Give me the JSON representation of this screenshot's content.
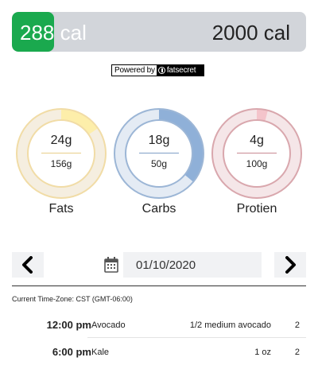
{
  "calories": {
    "consumed_label": "288 cal",
    "goal_label": "2000 cal",
    "progress": 0.144,
    "fill_color": "#1aa94e",
    "track_color": "#d2d5da"
  },
  "powered_by": {
    "prefix": "Powered by",
    "brand": "fatsecret"
  },
  "macros": [
    {
      "name": "Fats",
      "value": "24g",
      "goal": "156g",
      "fraction": 0.154,
      "fill": "#fdeeaa",
      "track": "#f5eee0",
      "ring": "#f1dca6",
      "line": "#e8cf8a"
    },
    {
      "name": "Carbs",
      "value": "18g",
      "goal": "50g",
      "fraction": 0.36,
      "fill": "#8fb0d8",
      "track": "#e4ebf4",
      "ring": "#9cb6d6",
      "line": "#7f9fc6"
    },
    {
      "name": "Protien",
      "value": "4g",
      "goal": "100g",
      "fraction": 0.04,
      "fill": "#f4c4cb",
      "track": "#f5e6e8",
      "ring": "#d9a7ad",
      "line": "#c98a93"
    }
  ],
  "date_nav": {
    "prev_icon": "chevron-left-icon",
    "next_icon": "chevron-right-icon",
    "calendar_icon": "calendar-icon",
    "date_value": "01/10/2020"
  },
  "timezone_text": "Current Time-Zone: CST (GMT-06:00)",
  "log": [
    {
      "time": "12:00 pm",
      "food": "Avocado",
      "serving": "1/2 medium avocado",
      "qty": "2"
    },
    {
      "time": "6:00 pm",
      "food": "Kale",
      "serving": "1 oz",
      "qty": "2"
    }
  ]
}
